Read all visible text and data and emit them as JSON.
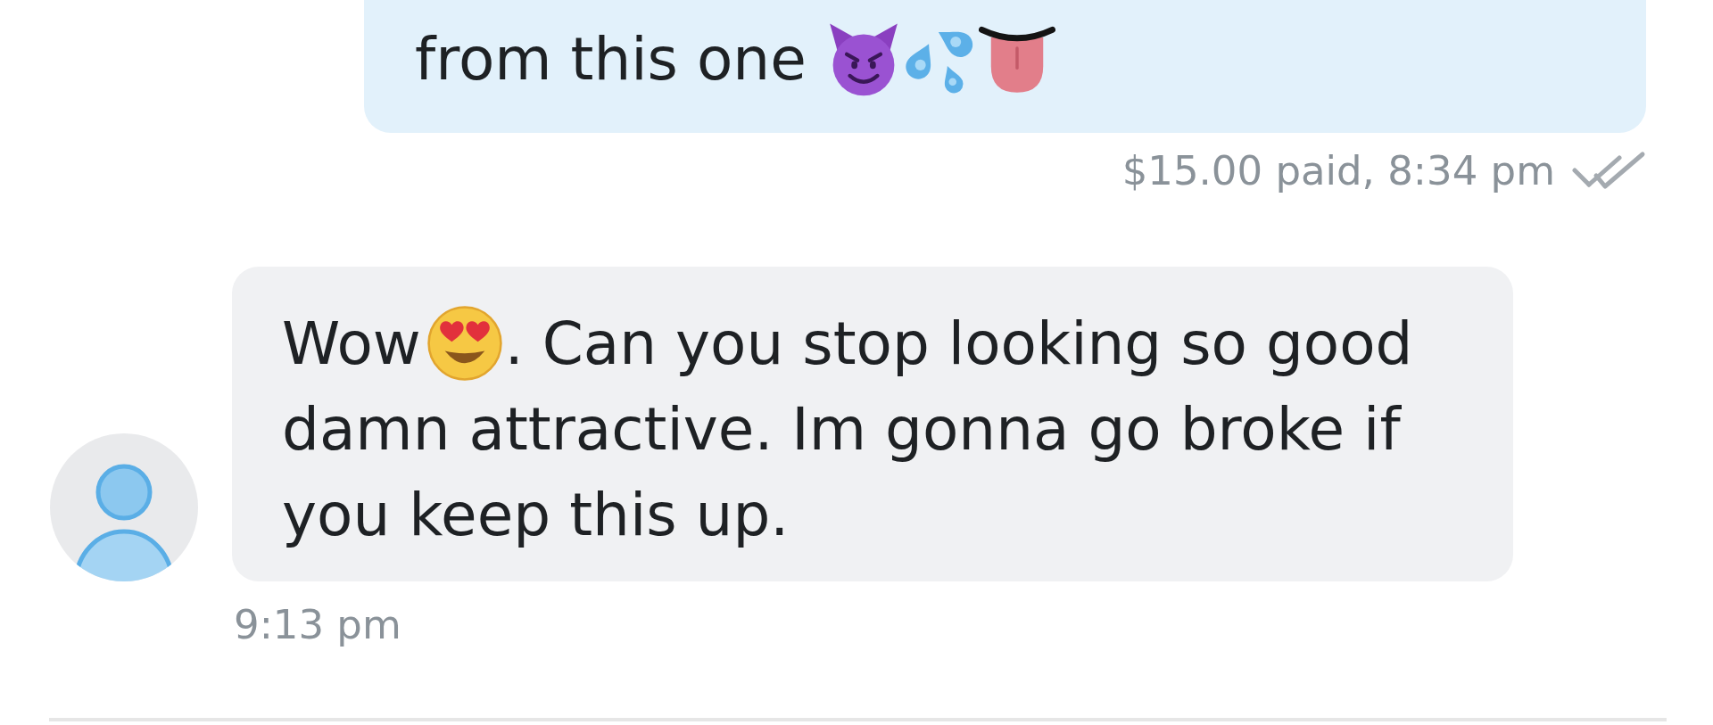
{
  "outgoing_message": {
    "parts": [
      {
        "kind": "text",
        "text": "from this one "
      },
      {
        "kind": "devil"
      },
      {
        "kind": "droplets"
      },
      {
        "kind": "tongue"
      }
    ],
    "status": "$15.00 paid, 8:34 pm",
    "read": true
  },
  "incoming_message": {
    "lines": [
      {
        "parts": [
          {
            "kind": "text",
            "text": "Wow"
          },
          {
            "kind": "heart-eyes"
          },
          {
            "kind": "text",
            "text": ". Can you stop looking so good"
          }
        ]
      },
      {
        "parts": [
          {
            "kind": "text",
            "text": "damn attractive. Im gonna go broke if"
          }
        ]
      },
      {
        "parts": [
          {
            "kind": "text",
            "text": "you keep this up."
          }
        ]
      }
    ],
    "time": "9:13 pm"
  }
}
